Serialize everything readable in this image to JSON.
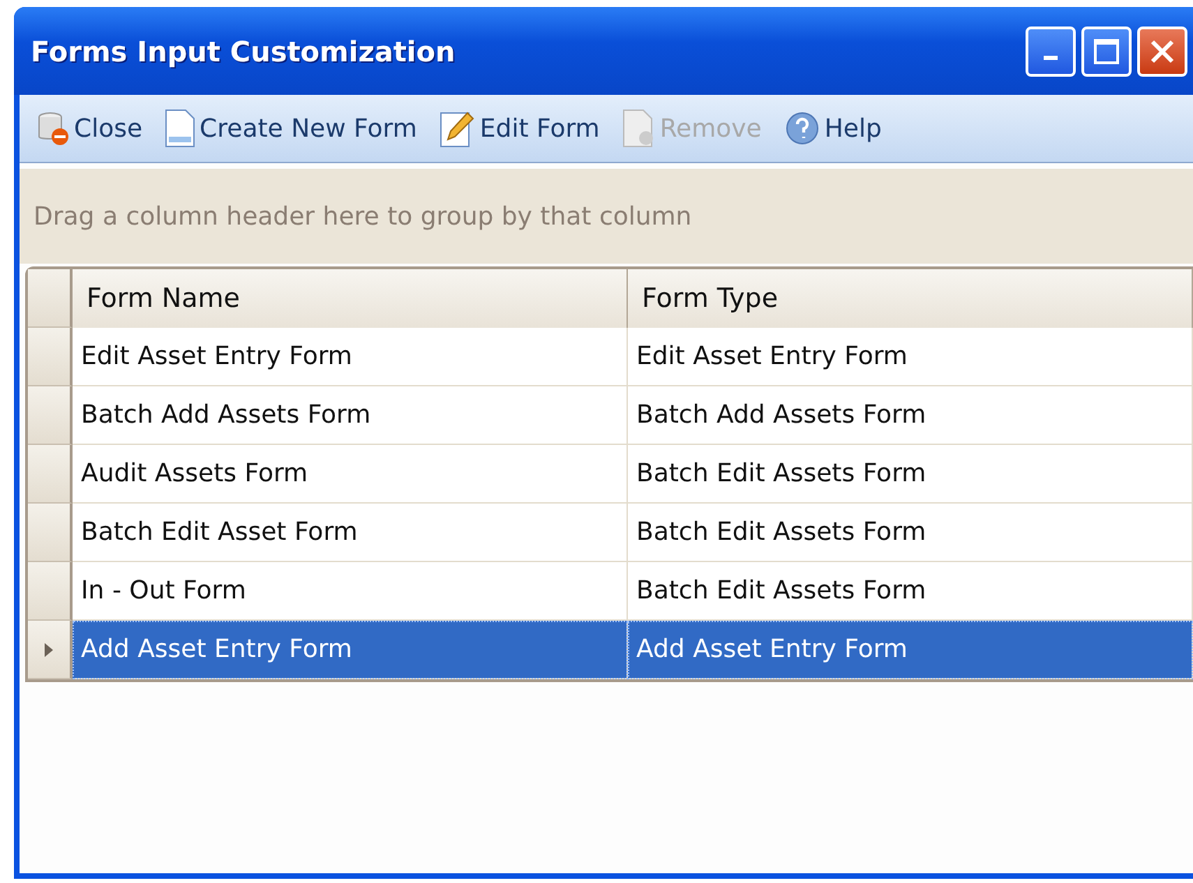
{
  "window": {
    "title": "Forms Input Customization"
  },
  "toolbar": [
    {
      "kind": "close",
      "label": "Close",
      "disabled": false
    },
    {
      "kind": "new",
      "label": "Create New Form",
      "disabled": false
    },
    {
      "kind": "edit",
      "label": "Edit Form",
      "disabled": false
    },
    {
      "kind": "remove",
      "label": "Remove",
      "disabled": true
    },
    {
      "kind": "help",
      "label": "Help",
      "disabled": false
    }
  ],
  "group_panel": {
    "hint": "Drag a column header here to group by that column"
  },
  "table": {
    "columns": [
      "Form Name",
      "Form Type"
    ],
    "rows": [
      {
        "cells": [
          "Edit Asset Entry Form",
          "Edit Asset Entry Form"
        ],
        "selected": false
      },
      {
        "cells": [
          "Batch Add Assets Form",
          "Batch Add Assets Form"
        ],
        "selected": false
      },
      {
        "cells": [
          "Audit Assets Form",
          "Batch Edit Assets Form"
        ],
        "selected": false
      },
      {
        "cells": [
          "Batch Edit Asset Form",
          "Batch Edit Assets Form"
        ],
        "selected": false
      },
      {
        "cells": [
          "In - Out Form",
          "Batch Edit Assets Form"
        ],
        "selected": false
      },
      {
        "cells": [
          "Add Asset Entry Form",
          "Add Asset Entry Form"
        ],
        "selected": true
      }
    ]
  }
}
